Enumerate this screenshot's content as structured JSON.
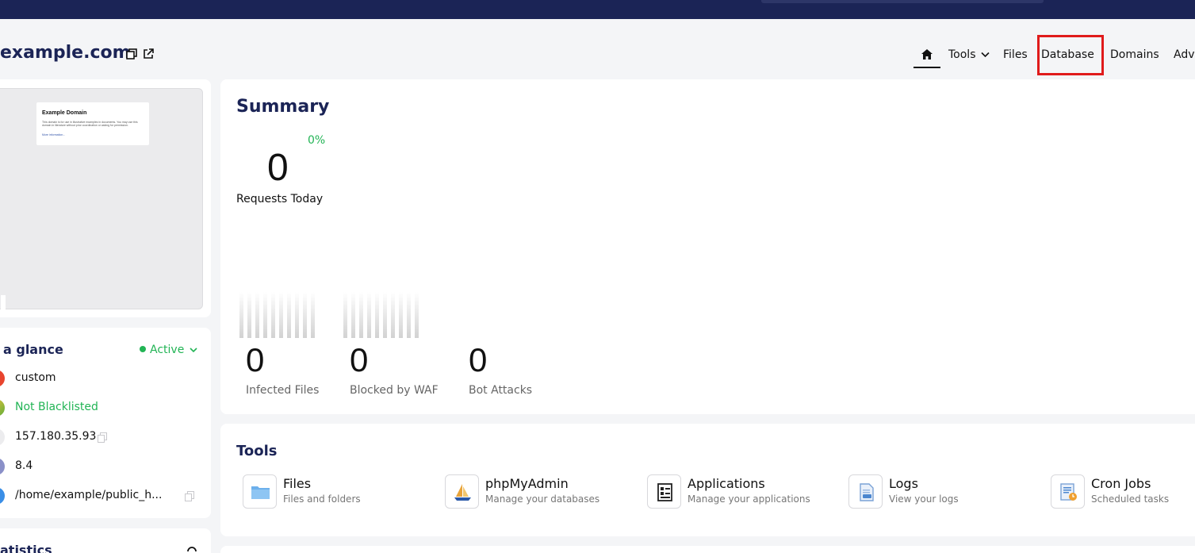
{
  "domain": {
    "title": "example.com"
  },
  "nav": {
    "home_icon": "home-icon",
    "items": [
      "Tools",
      "Files",
      "Database",
      "Domains",
      "Adv"
    ],
    "tools_chevron": "chevron-down-icon"
  },
  "preview": {
    "site_title": "Example Domain",
    "site_text": "This domain is for use in illustrative examples in documents. You may use this domain in literature without prior coordination or asking for permission.",
    "site_link": "More information..."
  },
  "glance": {
    "title": "a glance",
    "status": "Active",
    "rows": [
      {
        "text": "custom",
        "icon": "nameserver-icon"
      },
      {
        "text": "Not Blacklisted",
        "icon": "blacklist-icon"
      },
      {
        "text": "157.180.35.93",
        "icon": "ip-icon"
      },
      {
        "text": "8.4",
        "icon": "php-icon"
      },
      {
        "text": "/home/example/public_h...",
        "icon": "folder-path-icon"
      }
    ]
  },
  "statistics": {
    "title": "atistics"
  },
  "summary": {
    "title": "Summary",
    "change_pct": "0%",
    "requests": {
      "value": "0",
      "label": "Requests Today"
    },
    "stats": [
      {
        "value": "0",
        "label": "Infected Files"
      },
      {
        "value": "0",
        "label": "Blocked by WAF"
      },
      {
        "value": "0",
        "label": "Bot Attacks"
      }
    ]
  },
  "tools": {
    "title": "Tools",
    "items": [
      {
        "name": "Files",
        "desc": "Files and folders",
        "icon": "folder-icon"
      },
      {
        "name": "phpMyAdmin",
        "desc": "Manage your databases",
        "icon": "phpmyadmin-icon"
      },
      {
        "name": "Applications",
        "desc": "Manage your applications",
        "icon": "applications-icon"
      },
      {
        "name": "Logs",
        "desc": "View your logs",
        "icon": "logs-icon"
      },
      {
        "name": "Cron Jobs",
        "desc": "Scheduled tasks",
        "icon": "cron-jobs-icon"
      }
    ]
  },
  "colors": {
    "brand_navy": "#1b2456",
    "success_green": "#22b455",
    "highlight_red": "#e01b1b"
  }
}
